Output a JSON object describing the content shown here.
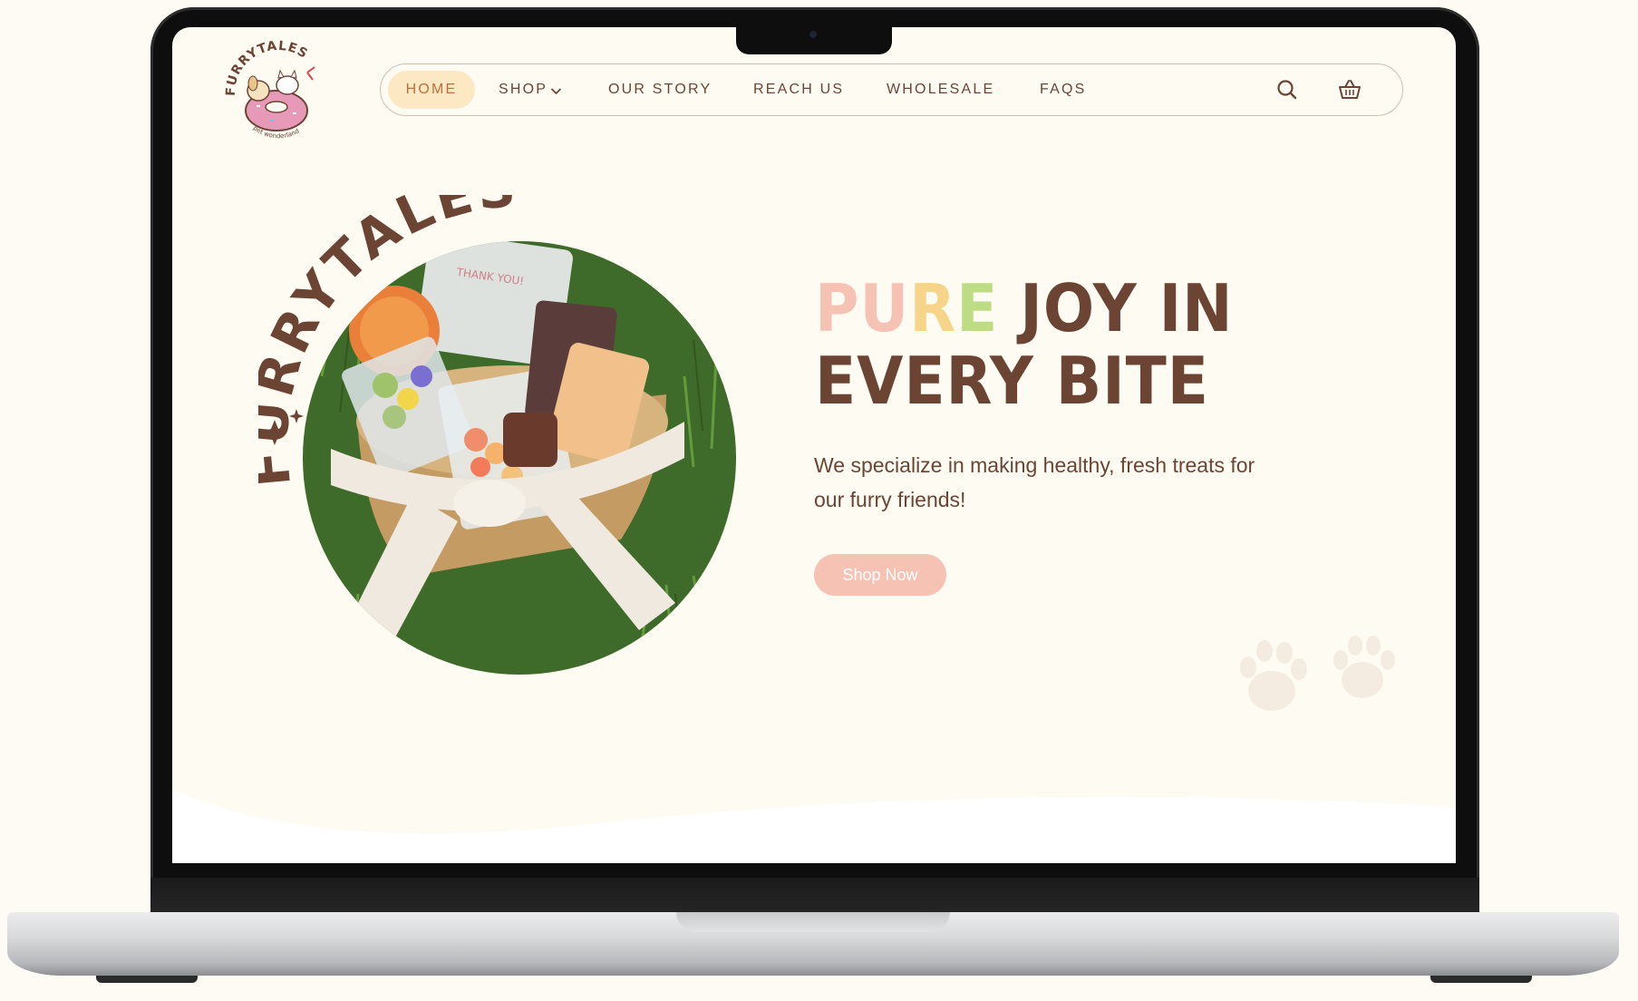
{
  "brand": {
    "logo_text": "FURRYTALES",
    "logo_tagline": "pet wonderland"
  },
  "nav": {
    "items": [
      {
        "label": "HOME",
        "active": true
      },
      {
        "label": "SHOP",
        "has_dropdown": true
      },
      {
        "label": "OUR STORY"
      },
      {
        "label": "REACH US"
      },
      {
        "label": "WHOLESALE"
      },
      {
        "label": "FAQS"
      }
    ],
    "icons": [
      "search-icon",
      "basket-icon"
    ]
  },
  "hero": {
    "arc_text": "FURRYTALES",
    "card_text": "THANK YOU!",
    "headline_word1_letters": [
      "P",
      "U",
      "R",
      "E"
    ],
    "headline_line1_rest": "JOY IN",
    "headline_line2": "EVERY BITE",
    "subtitle": "We specialize in making healthy, fresh treats for our furry friends!",
    "cta_label": "Shop Now"
  },
  "colors": {
    "brown": "#6b4434",
    "pink": "#f6c2b4",
    "yellow": "#f6d58a",
    "green": "#bedc84",
    "nav_active_bg": "#fde8c4",
    "page_bg": "#fefbf3"
  }
}
